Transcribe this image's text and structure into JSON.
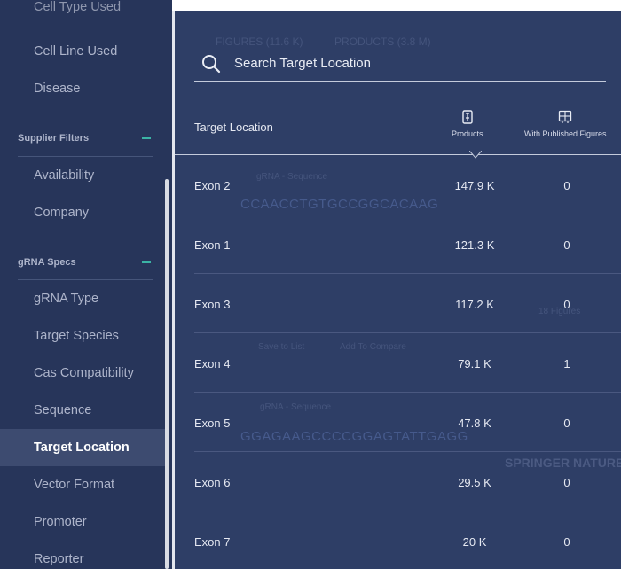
{
  "sidebar": {
    "cut_item": "Cell Type Used",
    "items_top": [
      "Cell Line Used",
      "Disease"
    ],
    "supplier_filters": {
      "title": "Supplier Filters",
      "items": [
        "Availability",
        "Company"
      ]
    },
    "grna_specs": {
      "title": "gRNA Specs",
      "items": [
        "gRNA Type",
        "Target Species",
        "Cas Compatibility",
        "Sequence",
        "Target Location",
        "Vector Format",
        "Promoter",
        "Reporter"
      ],
      "active": "Target Location"
    }
  },
  "background": {
    "tab_figures": "FIGURES (11.6 K)",
    "tab_products": "PRODUCTS (3.8 M)",
    "seq_label_1": "gRNA - Sequence",
    "seq_1": "CCAACCTGTGCCGGCACAAG",
    "save_to_list": "Save to List",
    "add_to_compare": "Add To Compare",
    "seq_label_2": "gRNA - Sequence",
    "seq_2": "GGAGAAGCCCCGGAGTATTGAGG",
    "figure_caption": "18 Figures",
    "brand": "SPRINGER NATURE"
  },
  "search": {
    "placeholder": "Search Target Location",
    "icon": "search-icon"
  },
  "table": {
    "column_label": "Target Location",
    "products_header": "Products",
    "figures_header": "With Published Figures",
    "rows": [
      {
        "location": "Exon 2",
        "products": "147.9 K",
        "figures": "0"
      },
      {
        "location": "Exon 1",
        "products": "121.3 K",
        "figures": "0"
      },
      {
        "location": "Exon 3",
        "products": "117.2 K",
        "figures": "0"
      },
      {
        "location": "Exon 4",
        "products": "79.1 K",
        "figures": "1"
      },
      {
        "location": "Exon 5",
        "products": "47.8 K",
        "figures": "0"
      },
      {
        "location": "Exon 6",
        "products": "29.5 K",
        "figures": "0"
      },
      {
        "location": "Exon 7",
        "products": "20 K",
        "figures": "0"
      }
    ]
  },
  "colors": {
    "sidebar_bg": "#27355a",
    "panel_bg": "#2e3e66",
    "active_item_bg": "#3d4b70",
    "accent": "#3bb3a5"
  }
}
